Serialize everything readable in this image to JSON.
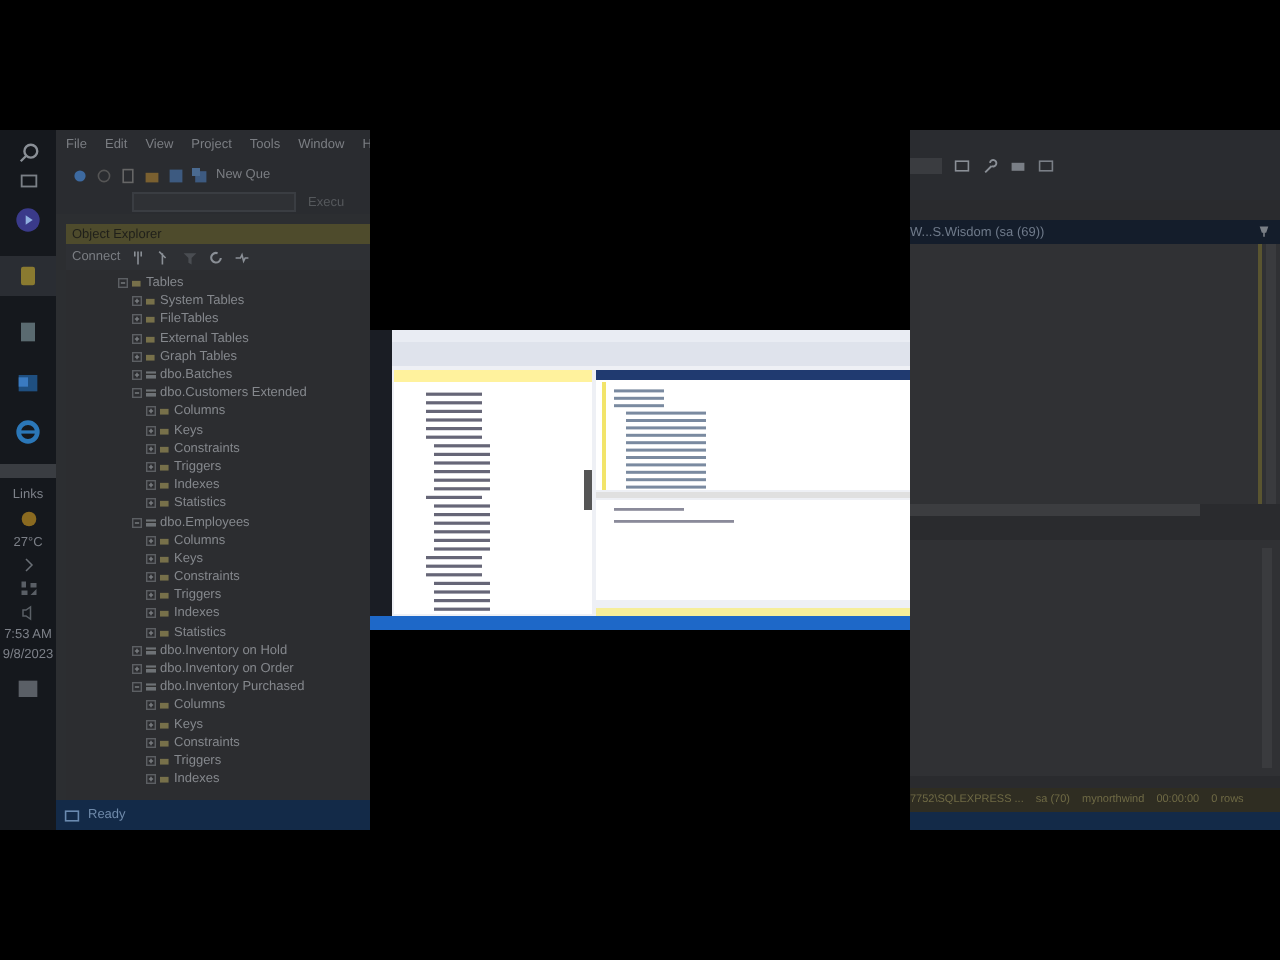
{
  "taskbar": {
    "widgets_label": "Links",
    "temperature": "27°C",
    "time": "7:53 AM",
    "date": "9/8/2023"
  },
  "menu": [
    "File",
    "Edit",
    "View",
    "Project",
    "Tools",
    "Window",
    "H"
  ],
  "toolbar": {
    "new_query": "New Que",
    "execute": "Execu"
  },
  "object_explorer": {
    "title": "Object Explorer",
    "connect": "Connect"
  },
  "tree": [
    {
      "label": "Tables",
      "kind": "folder",
      "expanded": true,
      "children": [
        {
          "label": "System Tables",
          "kind": "folder",
          "expanded": false
        },
        {
          "label": "FileTables",
          "kind": "folder",
          "expanded": false
        },
        {
          "label": "External Tables",
          "kind": "folder",
          "expanded": false
        },
        {
          "label": "Graph Tables",
          "kind": "folder",
          "expanded": false
        },
        {
          "label": "dbo.Batches",
          "kind": "table",
          "expanded": false
        },
        {
          "label": "dbo.Customers Extended",
          "kind": "table",
          "expanded": true,
          "children": [
            {
              "label": "Columns",
              "kind": "folder",
              "expanded": false
            },
            {
              "label": "Keys",
              "kind": "folder",
              "expanded": false
            },
            {
              "label": "Constraints",
              "kind": "folder",
              "expanded": false
            },
            {
              "label": "Triggers",
              "kind": "folder",
              "expanded": false
            },
            {
              "label": "Indexes",
              "kind": "folder",
              "expanded": false
            },
            {
              "label": "Statistics",
              "kind": "folder",
              "expanded": false
            }
          ]
        },
        {
          "label": "dbo.Employees",
          "kind": "table",
          "expanded": true,
          "children": [
            {
              "label": "Columns",
              "kind": "folder",
              "expanded": false
            },
            {
              "label": "Keys",
              "kind": "folder",
              "expanded": false
            },
            {
              "label": "Constraints",
              "kind": "folder",
              "expanded": false
            },
            {
              "label": "Triggers",
              "kind": "folder",
              "expanded": false
            },
            {
              "label": "Indexes",
              "kind": "folder",
              "expanded": false
            },
            {
              "label": "Statistics",
              "kind": "folder",
              "expanded": false
            }
          ]
        },
        {
          "label": "dbo.Inventory on Hold",
          "kind": "table",
          "expanded": false
        },
        {
          "label": "dbo.Inventory on Order",
          "kind": "table",
          "expanded": false
        },
        {
          "label": "dbo.Inventory Purchased",
          "kind": "table",
          "expanded": true,
          "children": [
            {
              "label": "Columns",
              "kind": "folder",
              "expanded": false
            },
            {
              "label": "Keys",
              "kind": "folder",
              "expanded": false
            },
            {
              "label": "Constraints",
              "kind": "folder",
              "expanded": false
            },
            {
              "label": "Triggers",
              "kind": "folder",
              "expanded": false
            },
            {
              "label": "Indexes",
              "kind": "folder",
              "expanded": false
            }
          ]
        }
      ]
    }
  ],
  "status_bar": {
    "left": "Ready",
    "items": [
      "7752\\SQLEXPRESS ...",
      "sa (70)",
      "mynorthwind",
      "00:00:00",
      "0 rows"
    ]
  },
  "query_tab": {
    "title": "W...S.Wisdom (sa (69))"
  }
}
